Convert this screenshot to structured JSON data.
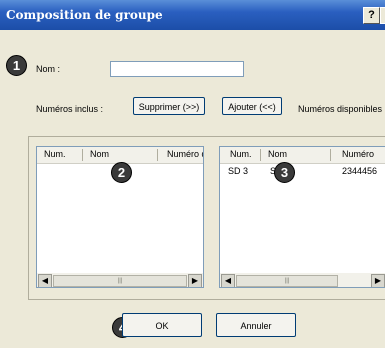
{
  "window": {
    "title": "Composition de groupe",
    "help_label": "?"
  },
  "badges": {
    "b1": "1",
    "b2": "2",
    "b3": "3",
    "b4": "4"
  },
  "form": {
    "name_label": "Nom :",
    "name_value": "",
    "included_label": "Numéros inclus :",
    "remove_button": "Supprimer (>>)",
    "add_button": "Ajouter (<<)",
    "available_label": "Numéros disponibles :"
  },
  "included_list": {
    "columns": [
      "Num.",
      "Nom",
      "Numéro de"
    ],
    "rows": []
  },
  "available_list": {
    "columns": [
      "Num.",
      "Nom",
      "Numéro"
    ],
    "rows": [
      {
        "num": "SD 3",
        "nom": "SMS",
        "numero": "2344456"
      }
    ]
  },
  "scroll": {
    "left_arrow": "◀",
    "right_arrow": "▶",
    "thumb_grip": "|||"
  },
  "footer": {
    "ok_button": "OK",
    "cancel_button": "Annuler"
  }
}
